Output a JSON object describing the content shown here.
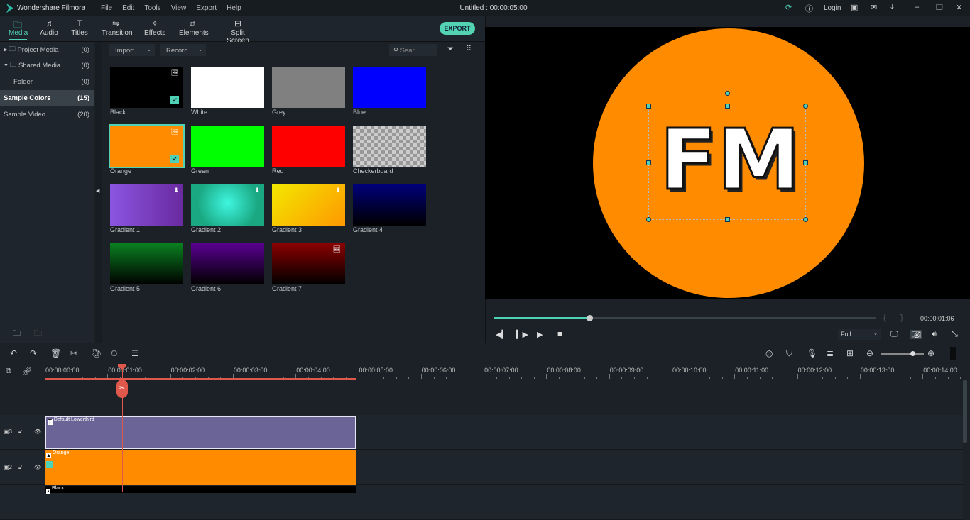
{
  "app": {
    "name": "Wondershare Filmora",
    "doc_title": "Untitled : 00:00:05:00",
    "menu": [
      "File",
      "Edit",
      "Tools",
      "View",
      "Export",
      "Help"
    ],
    "login": "Login"
  },
  "tabs": [
    {
      "label": "Media",
      "icon": "folder"
    },
    {
      "label": "Audio",
      "icon": "music"
    },
    {
      "label": "Titles",
      "icon": "T"
    },
    {
      "label": "Transition",
      "icon": "transition"
    },
    {
      "label": "Effects",
      "icon": "effects"
    },
    {
      "label": "Elements",
      "icon": "elements"
    },
    {
      "label": "Split Screen",
      "icon": "split"
    }
  ],
  "export_label": "EXPORT",
  "sidebar": [
    {
      "label": "Project Media",
      "count": "(0)"
    },
    {
      "label": "Shared Media",
      "count": "(0)"
    },
    {
      "label": "Folder",
      "count": "(0)"
    },
    {
      "label": "Sample Colors",
      "count": "(15)",
      "selected": true
    },
    {
      "label": "Sample Video",
      "count": "(20)"
    }
  ],
  "media_toolbar": {
    "import": "Import",
    "record": "Record",
    "search_placeholder": "Sear..."
  },
  "media": [
    {
      "label": "Black",
      "color": "#000000",
      "checked": true
    },
    {
      "label": "White",
      "color": "#ffffff"
    },
    {
      "label": "Grey",
      "color": "#808080"
    },
    {
      "label": "Blue",
      "color": "#0000ff"
    },
    {
      "label": "Orange",
      "color": "#ff8c00",
      "checked": true,
      "selected": true
    },
    {
      "label": "Green",
      "color": "#00ff00"
    },
    {
      "label": "Red",
      "color": "#ff0000"
    },
    {
      "label": "Checkerboard",
      "color": "checker"
    },
    {
      "label": "Gradient 1",
      "color": "linear-gradient(90deg,#8a55e0,#6a2aa0)"
    },
    {
      "label": "Gradient 2",
      "color": "radial-gradient(circle at 50% 45%,#3ff6e0,#1aa882 70%)"
    },
    {
      "label": "Gradient 3",
      "color": "linear-gradient(135deg,#f2e800,#ff9800)"
    },
    {
      "label": "Gradient 4",
      "color": "linear-gradient(180deg,#00007a,#000)"
    },
    {
      "label": "Gradient 5",
      "color": "linear-gradient(180deg,#0a8020,#000)"
    },
    {
      "label": "Gradient 6",
      "color": "linear-gradient(180deg,#5a0090,#000)"
    },
    {
      "label": "Gradient 7",
      "color": "linear-gradient(180deg,#8a0000,#000)"
    }
  ],
  "preview": {
    "text": "FM",
    "circle_color": "#ff8c00",
    "timecode": "00:00:01:06",
    "progress": 0.25,
    "quality": "Full"
  },
  "timeline": {
    "ticks": [
      "00:00:00:00",
      "00:00:01:00",
      "00:00:02:00",
      "00:00:03:00",
      "00:00:04:00",
      "00:00:05:00",
      "00:00:06:00",
      "00:00:07:00",
      "00:00:08:00",
      "00:00:09:00",
      "00:00:10:00",
      "00:00:11:00",
      "00:00:12:00",
      "00:00:13:00",
      "00:00:14:00"
    ],
    "clips": [
      {
        "label": "Default Lowerthird",
        "track": "3",
        "color": "#6b6496"
      },
      {
        "label": "Orange",
        "track": "2",
        "color": "#ff8c00"
      },
      {
        "label": "Black",
        "track": "1",
        "color": "#000000"
      }
    ]
  },
  "accent": "#4fd1b5"
}
